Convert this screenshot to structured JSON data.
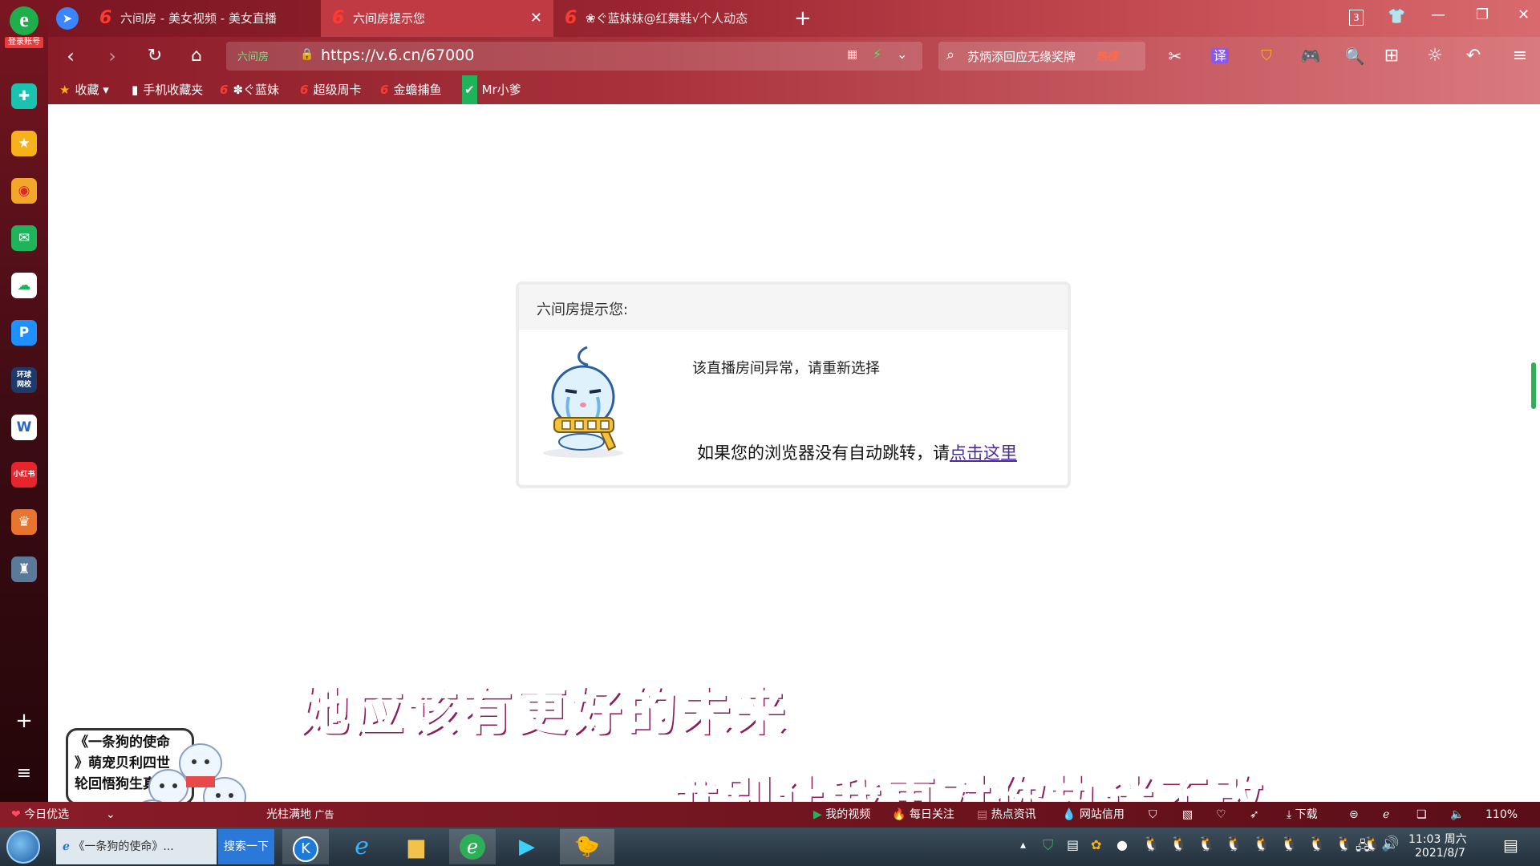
{
  "sidebar": {
    "login_label": "登录账号",
    "apps": [
      "加速器",
      "收藏",
      "微博",
      "邮箱",
      "云盘",
      "pp助手",
      "环球网校",
      "文档",
      "小红书",
      "游戏",
      "游戏2"
    ],
    "add_label": "+",
    "menu_label": "≡"
  },
  "tabs": [
    {
      "title": "六间房 - 美女视频 - 美女直播",
      "active": false
    },
    {
      "title": "六间房提示您",
      "active": true
    },
    {
      "title": "❀ぐ蓝妹妹@红舞鞋√个人动态",
      "active": false
    }
  ],
  "tab_count": "3",
  "address": {
    "site_tag": "六间房",
    "url": "https://v.6.cn/67000"
  },
  "search": {
    "query": "苏炳添回应无缘奖牌",
    "hot_label": "热搜"
  },
  "bookmarks": [
    {
      "label": "收藏"
    },
    {
      "label": "手机收藏夹"
    },
    {
      "label": "✽ぐ蓝妹"
    },
    {
      "label": "超级周卡"
    },
    {
      "label": "金蟾捕鱼"
    },
    {
      "label": "Mr小爹"
    }
  ],
  "dialog": {
    "title": "六间房提示您:",
    "message": "该直播房间异常，请重新选择",
    "redirect_text": "如果您的浏览器没有自动跳转，请",
    "redirect_link": "点击这里"
  },
  "subtitles": {
    "line1": "她应该有更好的未来",
    "line2": "就别让我再对你执迷不改"
  },
  "ad": {
    "line1": "《一条狗的使命",
    "line2": "》萌宠贝利四世",
    "line3": "轮回悟狗生真谛"
  },
  "statusbar": {
    "today_pick": "今日优选",
    "news_fragment": "光柱满地",
    "ad_tag": "广告",
    "my_video": "我的视频",
    "daily_follow": "每日关注",
    "hot_news": "热点资讯",
    "site_credit": "网站信用",
    "download": "下载",
    "zoom": "110%"
  },
  "taskbar": {
    "ie_window": "《一条狗的使命》...",
    "search_btn": "搜索一下",
    "time": "11:03 周六",
    "date": "2021/8/7"
  },
  "colors": {
    "chrome_dark": "#8a1c28",
    "accent_pink": "#f2479a",
    "link": "#4a2a9a",
    "safe_green": "#2fae5a"
  }
}
